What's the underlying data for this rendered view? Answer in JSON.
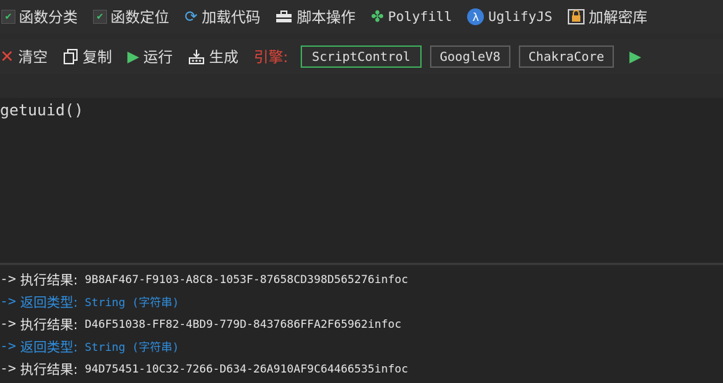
{
  "toolbar1": {
    "func_category": "函数分类",
    "func_locate": "函数定位",
    "load_code": "加载代码",
    "script_ops": "脚本操作",
    "polyfill": "Polyfill",
    "uglifyjs": "UglifyJS",
    "encrypt_decrypt": "加解密库"
  },
  "toolbar2": {
    "clear": "清空",
    "copy": "复制",
    "run": "运行",
    "generate": "生成",
    "engine_label": "引擎:",
    "engines": [
      "ScriptControl",
      "GoogleV8",
      "ChakraCore"
    ],
    "active_engine": "ScriptControl"
  },
  "editor": {
    "code": "getuuid()"
  },
  "output": [
    {
      "arrow": "->",
      "label": "执行结果:",
      "value": "9B8AF467-F9103-A8C8-1053F-87658CD398D565276infoc",
      "kind": "result"
    },
    {
      "arrow": "->",
      "label": "返回类型:",
      "value": "String (字符串)",
      "kind": "type"
    },
    {
      "arrow": "->",
      "label": "执行结果:",
      "value": "D46F51038-FF82-4BD9-779D-8437686FFA2F65962infoc",
      "kind": "result"
    },
    {
      "arrow": "->",
      "label": "返回类型:",
      "value": "String (字符串)",
      "kind": "type"
    },
    {
      "arrow": "->",
      "label": "执行结果:",
      "value": "94D75451-10C32-7266-D634-26A910AF9C64466535infoc",
      "kind": "result"
    }
  ],
  "icons": {
    "check": "check-icon",
    "reload": "reload-icon",
    "toolbox": "toolbox-icon",
    "polyfill": "puzzle-icon",
    "lambda": "lambda-icon",
    "lock": "lock-icon",
    "close": "close-icon",
    "copy": "copy-icon",
    "play": "play-icon",
    "generate": "generate-icon"
  },
  "colors": {
    "background": "#2b2b2b",
    "editor_bg": "#252526",
    "engine_label": "#e0463a",
    "active_engine_border": "#3ea85a",
    "type_text": "#2f8fdf"
  }
}
